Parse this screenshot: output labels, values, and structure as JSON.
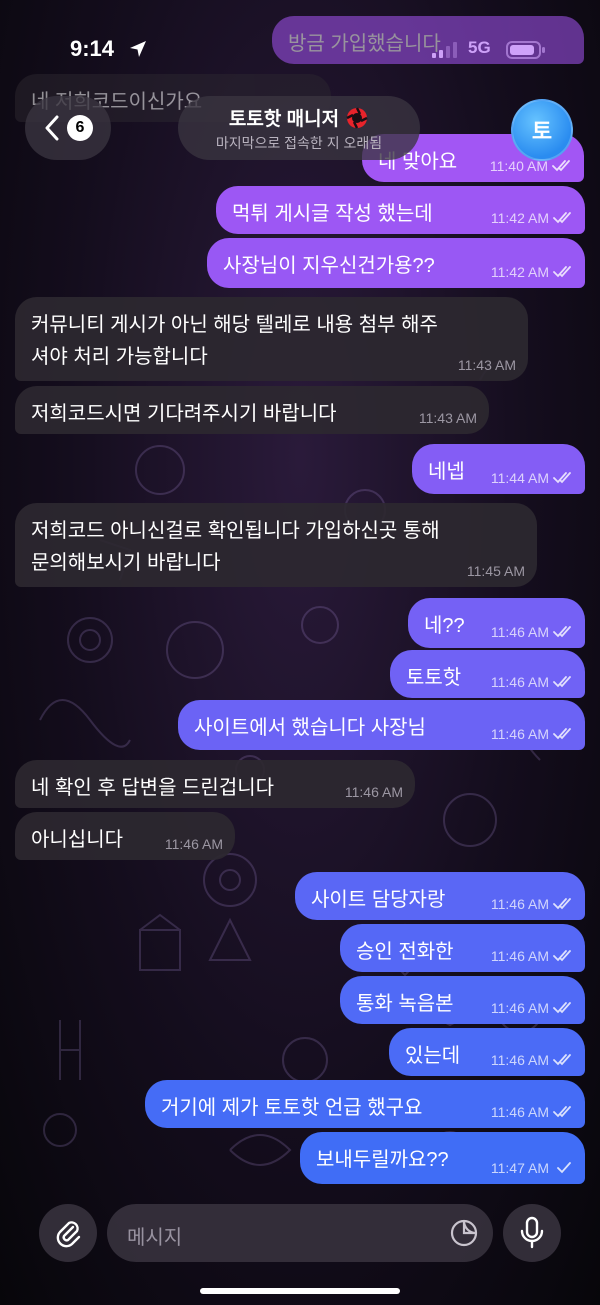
{
  "status_bar": {
    "time": "9:14",
    "network": "5G"
  },
  "header": {
    "back_count": "6",
    "title": "토토핫 매니저",
    "subtitle": "마지막으로 접속한 지 오래됨",
    "avatar_letter": "토"
  },
  "messages": [
    {
      "id": "m0",
      "dir": "out",
      "text": "방금 가입했습니다",
      "time": ""
    },
    {
      "id": "m1",
      "dir": "in",
      "text": "네 저희코드이신가요",
      "time": ""
    },
    {
      "id": "m2",
      "dir": "out",
      "text": "네 맞아요",
      "time": "11:40 AM"
    },
    {
      "id": "m3",
      "dir": "out",
      "text": "먹튀 게시글 작성 했는데",
      "time": "11:42 AM"
    },
    {
      "id": "m4",
      "dir": "out",
      "text": "사장님이 지우신건가용??",
      "time": "11:42 AM"
    },
    {
      "id": "m5",
      "dir": "in",
      "text": "커뮤니티 게시가 아닌 해당 텔레로 내용 첨부 해주",
      "text2": "셔야 처리 가능합니다",
      "time": "11:43 AM"
    },
    {
      "id": "m6",
      "dir": "in",
      "text": "저희코드시면 기다려주시기 바랍니다",
      "time": "11:43 AM"
    },
    {
      "id": "m7",
      "dir": "out",
      "text": "네넵",
      "time": "11:44 AM"
    },
    {
      "id": "m8",
      "dir": "in",
      "text": "저희코드 아니신걸로 확인됩니다 가입하신곳 통해",
      "text2": "문의해보시기 바랍니다",
      "time": "11:45 AM"
    },
    {
      "id": "m9",
      "dir": "out",
      "text": "네??",
      "time": "11:46 AM"
    },
    {
      "id": "m10",
      "dir": "out",
      "text": "토토핫",
      "time": "11:46 AM"
    },
    {
      "id": "m11",
      "dir": "out",
      "text": "사이트에서 했습니다 사장님",
      "time": "11:46 AM"
    },
    {
      "id": "m12",
      "dir": "in",
      "text": "네 확인 후 답변을 드린겁니다",
      "time": "11:46 AM"
    },
    {
      "id": "m13",
      "dir": "in",
      "text": "아니십니다",
      "time": "11:46 AM"
    },
    {
      "id": "m14",
      "dir": "out",
      "text": "사이트 담당자랑",
      "time": "11:46 AM"
    },
    {
      "id": "m15",
      "dir": "out",
      "text": "승인 전화한",
      "time": "11:46 AM"
    },
    {
      "id": "m16",
      "dir": "out",
      "text": "통화 녹음본",
      "time": "11:46 AM"
    },
    {
      "id": "m17",
      "dir": "out",
      "text": "있는데",
      "time": "11:46 AM"
    },
    {
      "id": "m18",
      "dir": "out",
      "text": "거기에 제가 토토핫 언급 했구요",
      "time": "11:46 AM"
    },
    {
      "id": "m19",
      "dir": "out",
      "text": "보내두릴까요??",
      "time": "11:47 AM"
    }
  ],
  "composer": {
    "placeholder": "메시지"
  },
  "colors": {
    "outgoing_top": "#9a51f2",
    "outgoing_bottom": "#3f6ff5",
    "incoming": "#2c2830",
    "avatar": "#2a8cf0"
  }
}
